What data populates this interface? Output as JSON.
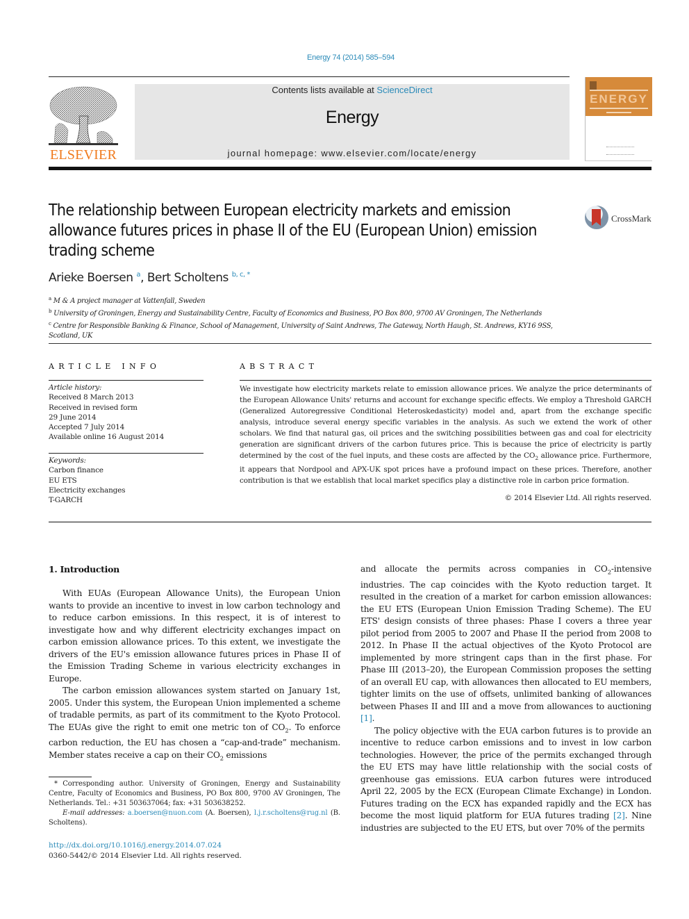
{
  "header": {
    "citation": "Energy 74 (2014) 585–594",
    "publisher": "ELSEVIER",
    "contents_prefix": "Contents lists available at ",
    "contents_link": "ScienceDirect",
    "journal": "Energy",
    "homepage": "journal homepage: www.elsevier.com/locate/energy",
    "cover_title": "ENERGY",
    "crossmark": "CrossMark",
    "colors": {
      "link": "#2a8ab8",
      "elsevier_orange": "#f07a1c",
      "cover_orange": "#d68a3a",
      "banner_gray": "#e6e6e6"
    }
  },
  "article": {
    "title": "The relationship between European electricity markets and emission allowance futures prices in phase II of the EU (European Union) emission trading scheme",
    "authors": [
      {
        "name": "Arieke Boersen",
        "marks": "a"
      },
      {
        "name": "Bert Scholtens",
        "marks": "b, c, *"
      }
    ],
    "affiliations": [
      {
        "mark": "a",
        "text": "M & A project manager at Vattenfall, Sweden"
      },
      {
        "mark": "b",
        "text": "University of Groningen, Energy and Sustainability Centre, Faculty of Economics and Business, PO Box 800, 9700 AV Groningen, The Netherlands"
      },
      {
        "mark": "c",
        "text": "Centre for Responsible Banking & Finance, School of Management, University of Saint Andrews, The Gateway, North Haugh, St. Andrews, KY16 9SS, Scotland, UK"
      }
    ]
  },
  "article_info": {
    "heading": "ARTICLE INFO",
    "history_label": "Article history:",
    "history": [
      "Received 8 March 2013",
      "Received in revised form",
      "29 June 2014",
      "Accepted 7 July 2014",
      "Available online 16 August 2014"
    ],
    "keywords_label": "Keywords:",
    "keywords": [
      "Carbon finance",
      "EU ETS",
      "Electricity exchanges",
      "T-GARCH"
    ]
  },
  "abstract": {
    "heading": "ABSTRACT",
    "text_1": "We investigate how electricity markets relate to emission allowance prices. We analyze the price determinants of the European Allowance Units' returns and account for exchange specific effects. We employ a Threshold GARCH (Generalized Autoregressive Conditional Heteroskedasticity) model and, apart from the exchange specific analysis, introduce several energy specific variables in the analysis. As such we extend the work of other scholars. We find that natural gas, oil prices and the switching possibilities between gas and coal for electricity generation are significant drivers of the carbon futures price. This is because the price of electricity is partly determined by the cost of the fuel inputs, and these costs are affected by the CO",
    "sub_1": "2",
    "text_2": " allowance price. Furthermore, it appears that Nordpool and APX-UK spot prices have a profound impact on these prices. Therefore, another contribution is that we establish that local market specifics play a distinctive role in carbon price formation.",
    "copyright": "© 2014 Elsevier Ltd. All rights reserved."
  },
  "body": {
    "section_heading": "1.  Introduction",
    "p1": "With EUAs (European Allowance Units), the European Union wants to provide an incentive to invest in low carbon technology and to reduce carbon emissions. In this respect, it is of interest to investigate how and why different electricity exchanges impact on carbon emission allowance prices. To this extent, we investigate the drivers of the EU's emission allowance futures prices in Phase II of the Emission Trading Scheme in various electricity exchanges in Europe.",
    "p2_a": "The carbon emission allowances system started on January 1st, 2005. Under this system, the European Union implemented a scheme of tradable permits, as part of its commitment to the Kyoto Protocol. The EUAs give the right to emit one metric ton of CO",
    "p2_sub1": "2",
    "p2_b": ". To enforce carbon reduction, the EU has chosen a “cap-and-trade” mechanism. Member states receive a cap on their CO",
    "p2_sub2": "2",
    "p2_c": " emissions",
    "r1_a": "and allocate the permits across companies in CO",
    "r1_sub": "2",
    "r1_b": "-intensive industries. The cap coincides with the Kyoto reduction target. It resulted in the creation of a market for carbon emission allowances: the EU ETS (European Union Emission Trading Scheme). The EU ETS' design consists of three phases: Phase I covers a three year pilot period from 2005 to 2007 and Phase II the period from 2008 to 2012. In Phase II the actual objectives of the Kyoto Protocol are implemented by more stringent caps than in the first phase. For Phase III (2013–20), the European Commission proposes the setting of an overall EU cap, with allowances then allocated to EU members, tighter limits on the use of offsets, unlimited banking of allowances between Phases II and III and a move from allowances to auctioning ",
    "r1_ref": "[1]",
    "r1_end": ".",
    "r2_a": "The policy objective with the EUA carbon futures is to provide an incentive to reduce carbon emissions and to invest in low carbon technologies. However, the price of the permits exchanged through the EU ETS may have little relationship with the social costs of greenhouse gas emissions. EUA carbon futures were introduced April 22, 2005 by the ECX (European Climate Exchange) in London. Futures trading on the ECX has expanded rapidly and the ECX has become the most liquid platform for EUA futures trading ",
    "r2_ref": "[2]",
    "r2_b": ". Nine industries are subjected to the EU ETS, but over 70% of the permits"
  },
  "footnote": {
    "corresponding": "* Corresponding author. University of Groningen, Energy and Sustainability Centre, Faculty of Economics and Business, PO Box 800, 9700 AV Groningen, The Netherlands. Tel.: +31 503637064; fax: +31 503638252.",
    "email_label": "E-mail addresses:",
    "email_1": "a.boersen@nuon.com",
    "email_1_name": " (A. Boersen), ",
    "email_2": "l.j.r.scholtens@rug.nl",
    "email_2_name": " (B. Scholtens).",
    "doi": "http://dx.doi.org/10.1016/j.energy.2014.07.024",
    "issn": "0360-5442/© 2014 Elsevier Ltd. All rights reserved."
  }
}
